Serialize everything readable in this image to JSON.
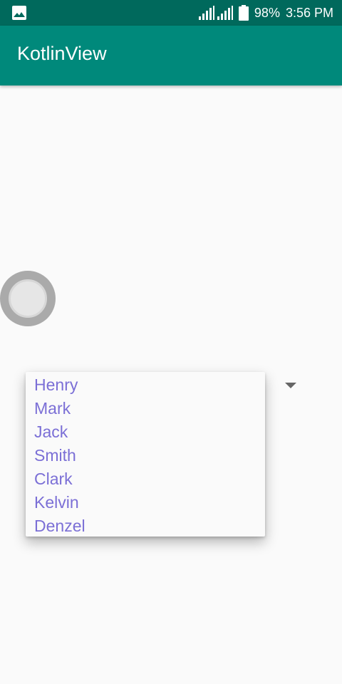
{
  "status_bar": {
    "battery": "98%",
    "time": "3:56 PM",
    "notification_icon": "image-icon"
  },
  "app_bar": {
    "title": "KotlinView"
  },
  "switch": {
    "state": "off"
  },
  "spinner": {
    "options": [
      "Henry",
      "Mark",
      "Jack",
      "Smith",
      "Clark",
      "Kelvin",
      "Denzel"
    ]
  },
  "colors": {
    "status_bar": "#00695c",
    "app_bar": "#00897b",
    "dropdown_text": "#7b6fd6"
  }
}
